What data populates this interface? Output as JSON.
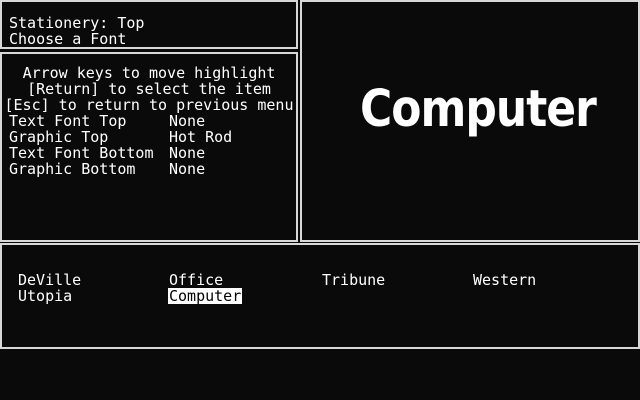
{
  "header": {
    "stationery": "Stationery: Top",
    "prompt": "Choose a Font"
  },
  "instructions": [
    "Arrow keys to move highlight",
    "[Return] to select the item",
    "[Esc] to return to previous menu"
  ],
  "options": [
    {
      "label": "Text Font Top",
      "value": "None"
    },
    {
      "label": "Graphic Top",
      "value": "Hot Rod"
    },
    {
      "label": "Text Font Bottom",
      "value": "None"
    },
    {
      "label": "Graphic Bottom",
      "value": "None"
    }
  ],
  "preview": {
    "text": "Computer"
  },
  "fonts": {
    "items": [
      "DeVille",
      "Office",
      "Tribune",
      "Western",
      "Utopia",
      "Computer"
    ],
    "selected": "Computer"
  },
  "colors": {
    "background": "#0a0a0a",
    "border": "#d8d8d8",
    "text": "#ffffff",
    "highlight_bg": "#ffffff",
    "highlight_text": "#000000"
  }
}
